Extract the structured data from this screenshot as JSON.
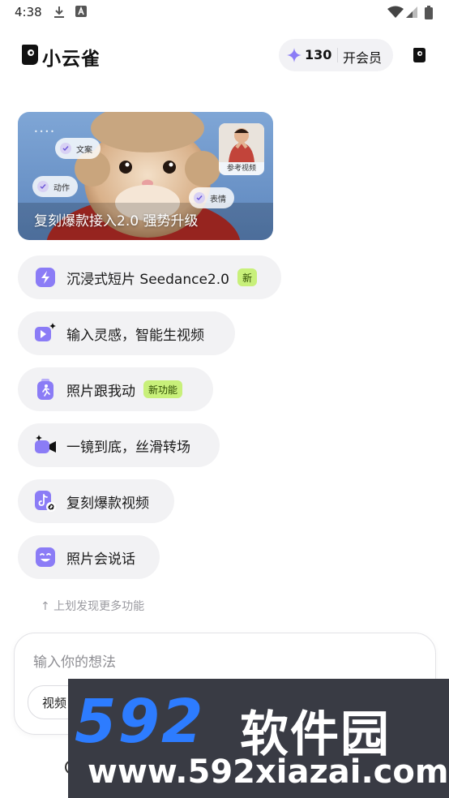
{
  "status_bar": {
    "time": "4:38",
    "icons": [
      "download-icon",
      "font-a-icon",
      "wifi-icon",
      "cellular-signal-icon",
      "battery-icon"
    ]
  },
  "header": {
    "app_name": "小云雀",
    "credits": "130",
    "member_label": "开会员",
    "icons": [
      "app-logo-icon",
      "sparkle-icon",
      "notebook-icon"
    ]
  },
  "banner": {
    "title": "复刻爆款接入2.0 强势升级",
    "chips": [
      "文案",
      "动作",
      "表情"
    ],
    "reference_label": "参考视频"
  },
  "features": [
    {
      "label": "沉浸式短片 Seedance2.0",
      "badge": "新",
      "icon": "lightning-icon"
    },
    {
      "label": "输入灵感，智能生视频",
      "badge": "",
      "icon": "play-sparkle-icon"
    },
    {
      "label": "照片跟我动",
      "badge": "新功能",
      "icon": "running-person-icon"
    },
    {
      "label": "一镜到底，丝滑转场",
      "badge": "",
      "icon": "video-camera-icon"
    },
    {
      "label": "复刻爆款视频",
      "badge": "",
      "icon": "tiktok-link-icon"
    },
    {
      "label": "照片会说话",
      "badge": "",
      "icon": "smile-face-icon"
    }
  ],
  "swipe_hint": "↑ 上划发现更多功能",
  "composer": {
    "placeholder": "输入你的想法",
    "chip_label": "视频"
  },
  "watermark": {
    "brand_number": "592",
    "brand_text": "软件园",
    "url": "www.592xiazai.com"
  },
  "colors": {
    "accent_purple": "#8b7cf6",
    "badge_green": "#c8f07a",
    "pill_bg": "#f2f2f4",
    "watermark_blue": "#2d7cff"
  }
}
